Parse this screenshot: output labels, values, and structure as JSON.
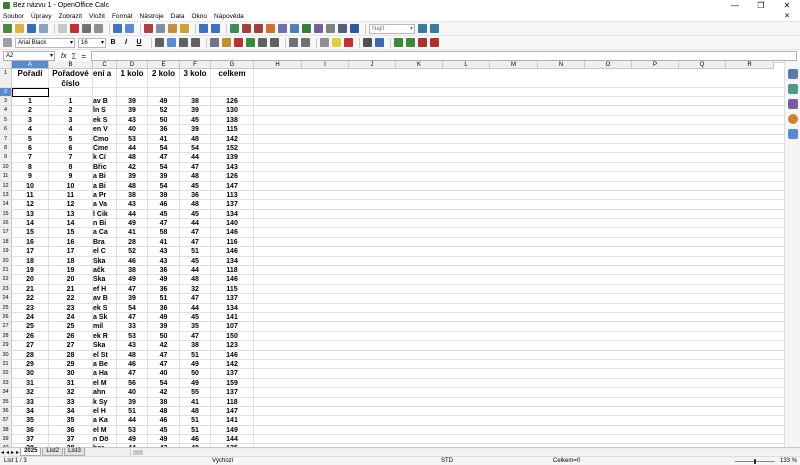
{
  "window": {
    "title": "Bez názvu 1 - OpenOffice Calc",
    "controls": [
      "—",
      "❐",
      "✕"
    ]
  },
  "menu": [
    "Soubor",
    "Úpravy",
    "Zobrazit",
    "Vložit",
    "Formát",
    "Nástroje",
    "Data",
    "Okno",
    "Nápověda"
  ],
  "menu_close": "✕",
  "toolbar": {
    "find_field": "Najít",
    "font_name": "Arial Black",
    "font_size": "16",
    "bold": "B",
    "italic": "I",
    "underline": "U"
  },
  "formula_bar": {
    "cell_ref": "A2",
    "fx": "fx",
    "sum": "Σ",
    "equals": "="
  },
  "colors": {
    "selection_header": "#5a8ad0",
    "header_bg": "#efefef",
    "gridline": "#e0e0e0"
  },
  "columns": [
    "A",
    "B",
    "C",
    "D",
    "E",
    "F",
    "G",
    "H",
    "I",
    "J",
    "K",
    "L",
    "M",
    "N",
    "O",
    "P",
    "Q",
    "R"
  ],
  "header_row": {
    "row_num": "1",
    "a": "Pořadí",
    "b": "Pořadové",
    "b2": "číslo",
    "c": "ení a",
    "d": "1 kolo",
    "e": "2 kolo",
    "f": "3 kolo",
    "g": "celkem"
  },
  "empty_row_num": "2",
  "rows": [
    {
      "r": "3",
      "a": "1",
      "b": "1",
      "c": "av B",
      "d": "39",
      "e": "49",
      "f": "38",
      "g": "126"
    },
    {
      "r": "4",
      "a": "2",
      "b": "2",
      "c": "ĺn S",
      "d": "39",
      "e": "52",
      "f": "39",
      "g": "130"
    },
    {
      "r": "5",
      "a": "3",
      "b": "3",
      "c": "ek S",
      "d": "43",
      "e": "50",
      "f": "45",
      "g": "138"
    },
    {
      "r": "6",
      "a": "4",
      "b": "4",
      "c": "en V",
      "d": "40",
      "e": "36",
      "f": "39",
      "g": "115"
    },
    {
      "r": "7",
      "a": "5",
      "b": "5",
      "c": "Čmo",
      "d": "53",
      "e": "41",
      "f": "48",
      "g": "142"
    },
    {
      "r": "8",
      "a": "6",
      "b": "6",
      "c": "Čme",
      "d": "44",
      "e": "54",
      "f": "54",
      "g": "152"
    },
    {
      "r": "9",
      "a": "7",
      "b": "7",
      "c": "k Cí",
      "d": "48",
      "e": "47",
      "f": "44",
      "g": "139"
    },
    {
      "r": "10",
      "a": "8",
      "b": "8",
      "c": "Břic",
      "d": "42",
      "e": "54",
      "f": "47",
      "g": "143"
    },
    {
      "r": "11",
      "a": "9",
      "b": "9",
      "c": "a Bi",
      "d": "39",
      "e": "39",
      "f": "48",
      "g": "126"
    },
    {
      "r": "12",
      "a": "10",
      "b": "10",
      "c": "a Bi",
      "d": "48",
      "e": "54",
      "f": "45",
      "g": "147"
    },
    {
      "r": "13",
      "a": "11",
      "b": "11",
      "c": "a Pr",
      "d": "38",
      "e": "39",
      "f": "36",
      "g": "113"
    },
    {
      "r": "14",
      "a": "12",
      "b": "12",
      "c": "a Va",
      "d": "43",
      "e": "46",
      "f": "48",
      "g": "137"
    },
    {
      "r": "15",
      "a": "13",
      "b": "13",
      "c": "l Cik",
      "d": "44",
      "e": "45",
      "f": "45",
      "g": "134"
    },
    {
      "r": "16",
      "a": "14",
      "b": "14",
      "c": "n Bi",
      "d": "49",
      "e": "47",
      "f": "44",
      "g": "140"
    },
    {
      "r": "17",
      "a": "15",
      "b": "15",
      "c": "a Ca",
      "d": "41",
      "e": "58",
      "f": "47",
      "g": "146"
    },
    {
      "r": "18",
      "a": "16",
      "b": "16",
      "c": "Bra",
      "d": "28",
      "e": "41",
      "f": "47",
      "g": "116"
    },
    {
      "r": "19",
      "a": "17",
      "b": "17",
      "c": "el C",
      "d": "52",
      "e": "43",
      "f": "51",
      "g": "146"
    },
    {
      "r": "20",
      "a": "18",
      "b": "18",
      "c": "Ska",
      "d": "46",
      "e": "43",
      "f": "45",
      "g": "134"
    },
    {
      "r": "21",
      "a": "19",
      "b": "19",
      "c": "ačk",
      "d": "38",
      "e": "36",
      "f": "44",
      "g": "118"
    },
    {
      "r": "22",
      "a": "20",
      "b": "20",
      "c": "Ška",
      "d": "49",
      "e": "49",
      "f": "48",
      "g": "146"
    },
    {
      "r": "23",
      "a": "21",
      "b": "21",
      "c": "ef H",
      "d": "47",
      "e": "36",
      "f": "32",
      "g": "115"
    },
    {
      "r": "24",
      "a": "22",
      "b": "22",
      "c": "av B",
      "d": "39",
      "e": "51",
      "f": "47",
      "g": "137"
    },
    {
      "r": "25",
      "a": "23",
      "b": "23",
      "c": "ek S",
      "d": "54",
      "e": "36",
      "f": "44",
      "g": "134"
    },
    {
      "r": "26",
      "a": "24",
      "b": "24",
      "c": "a Šk",
      "d": "47",
      "e": "49",
      "f": "45",
      "g": "141"
    },
    {
      "r": "27",
      "a": "25",
      "b": "25",
      "c": "mil",
      "d": "33",
      "e": "39",
      "f": "35",
      "g": "107"
    },
    {
      "r": "28",
      "a": "26",
      "b": "26",
      "c": "ek R",
      "d": "53",
      "e": "50",
      "f": "47",
      "g": "150"
    },
    {
      "r": "29",
      "a": "27",
      "b": "27",
      "c": "Ška",
      "d": "43",
      "e": "42",
      "f": "38",
      "g": "123"
    },
    {
      "r": "30",
      "a": "28",
      "b": "28",
      "c": "el St",
      "d": "48",
      "e": "47",
      "f": "51",
      "g": "146"
    },
    {
      "r": "31",
      "a": "29",
      "b": "29",
      "c": "a Be",
      "d": "46",
      "e": "47",
      "f": "49",
      "g": "142"
    },
    {
      "r": "32",
      "a": "30",
      "b": "30",
      "c": "a Ha",
      "d": "47",
      "e": "40",
      "f": "50",
      "g": "137"
    },
    {
      "r": "33",
      "a": "31",
      "b": "31",
      "c": "el M",
      "d": "56",
      "e": "54",
      "f": "49",
      "g": "159"
    },
    {
      "r": "34",
      "a": "32",
      "b": "32",
      "c": "ahn",
      "d": "40",
      "e": "42",
      "f": "55",
      "g": "137"
    },
    {
      "r": "35",
      "a": "33",
      "b": "33",
      "c": "k Sy",
      "d": "39",
      "e": "38",
      "f": "41",
      "g": "118"
    },
    {
      "r": "36",
      "a": "34",
      "b": "34",
      "c": "el H",
      "d": "51",
      "e": "48",
      "f": "48",
      "g": "147"
    },
    {
      "r": "37",
      "a": "35",
      "b": "35",
      "c": "a Ka",
      "d": "44",
      "e": "46",
      "f": "51",
      "g": "141"
    },
    {
      "r": "38",
      "a": "36",
      "b": "36",
      "c": "el M",
      "d": "53",
      "e": "45",
      "f": "51",
      "g": "149"
    },
    {
      "r": "39",
      "a": "37",
      "b": "37",
      "c": "n Dö",
      "d": "49",
      "e": "49",
      "f": "46",
      "g": "144"
    },
    {
      "r": "40",
      "a": "38",
      "b": "38",
      "c": "ber",
      "d": "44",
      "e": "43",
      "f": "48",
      "g": "135"
    }
  ],
  "tabs": [
    "2025",
    "List2",
    "List3"
  ],
  "status": {
    "sheet": "List 1 / 3",
    "style": "Výchozí",
    "mode": "STD",
    "sum": "Celkem=0",
    "zoom": "133 %"
  }
}
